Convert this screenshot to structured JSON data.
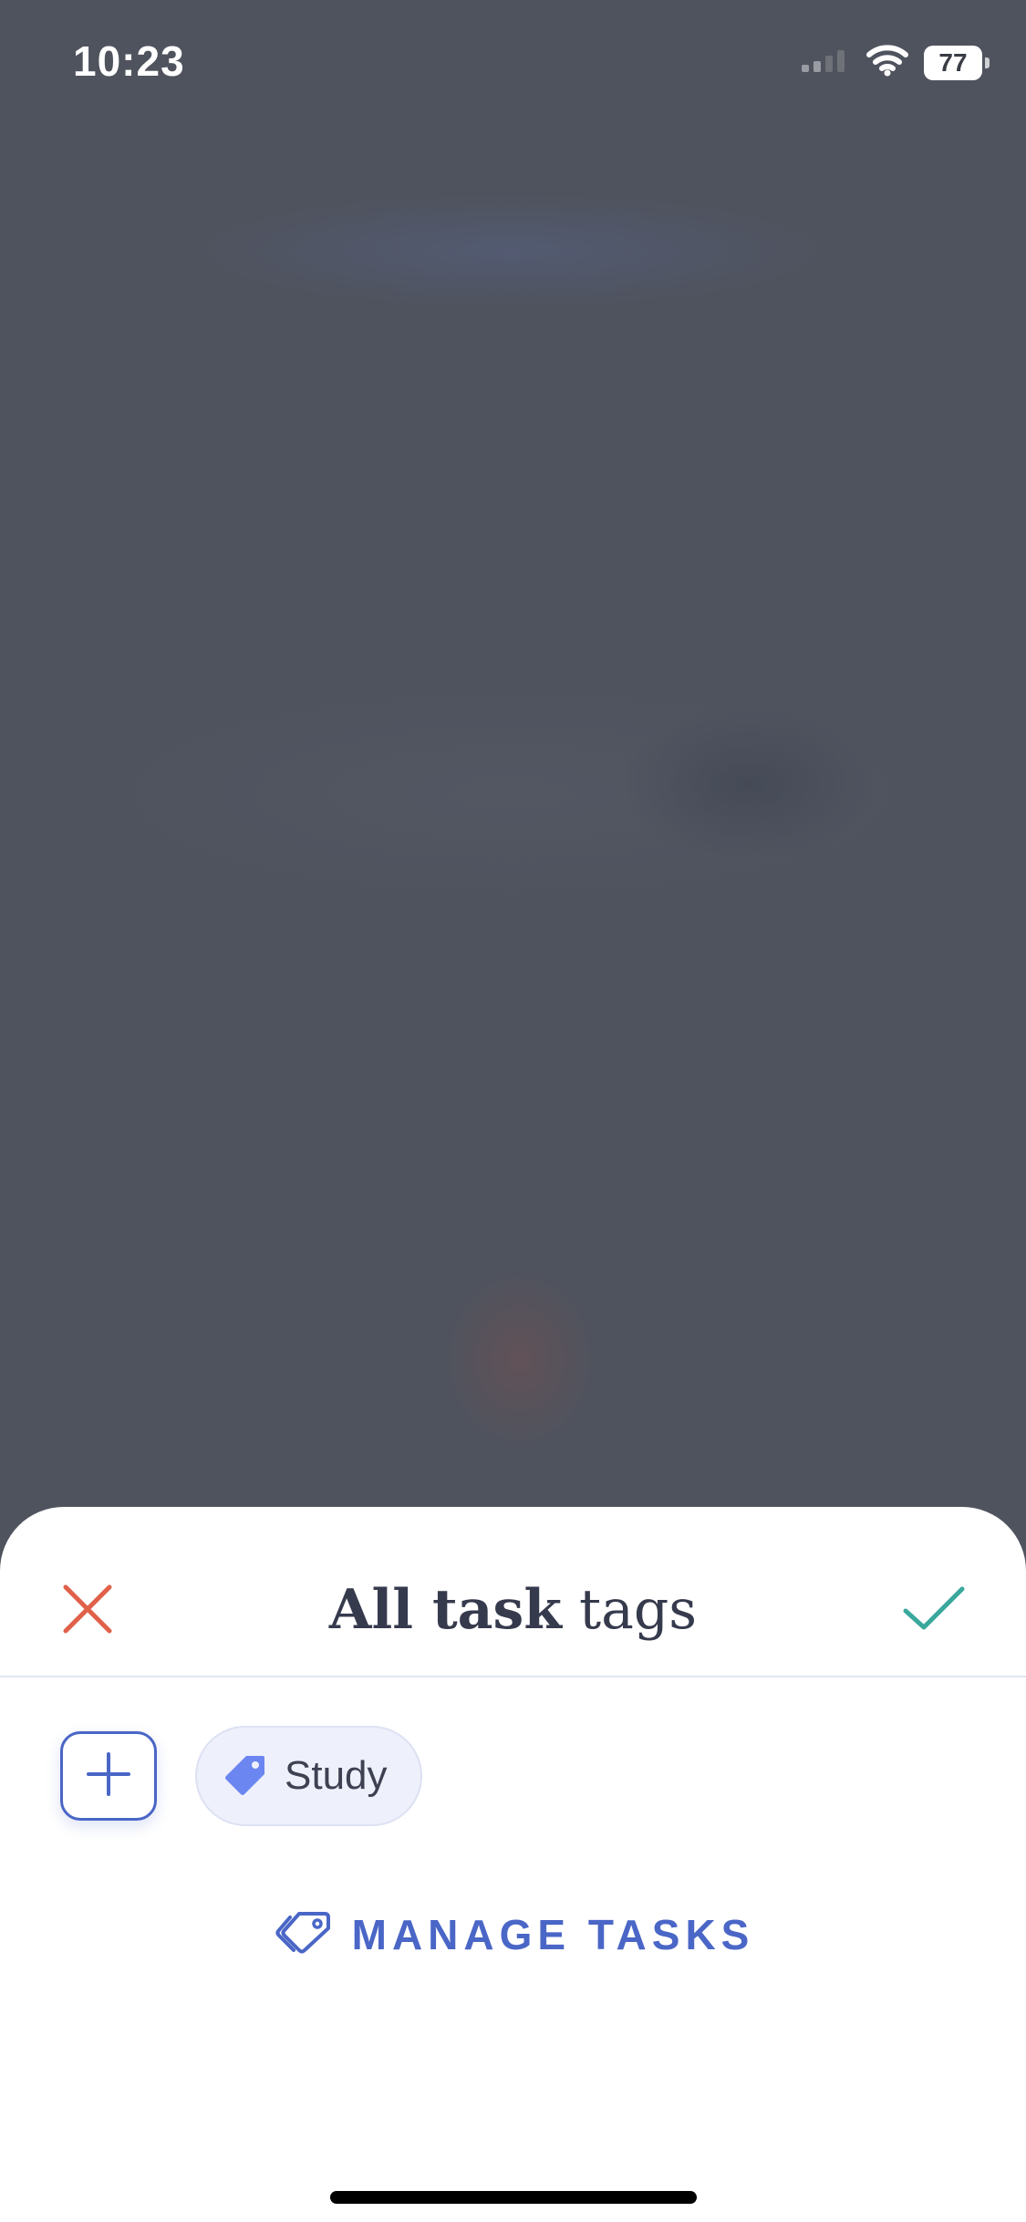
{
  "status_bar": {
    "time": "10:23",
    "battery_level": "77",
    "icons": [
      "signal-icon",
      "wifi-icon",
      "battery-icon"
    ]
  },
  "sheet": {
    "title_strong": "All task",
    "title_light": "tags",
    "close_icon": "close-icon",
    "confirm_icon": "checkmark-icon",
    "add_icon": "plus-icon",
    "tags": [
      {
        "label": "Study",
        "icon": "tag-icon"
      }
    ],
    "manage_label": "MANAGE TASKS",
    "manage_icon": "tags-icon"
  },
  "colors": {
    "accent": "#4a66c6",
    "close": "#e0614a",
    "confirm": "#3aa89c",
    "title": "#363a4d",
    "tag_icon": "#6b86f0",
    "overlay": "#4f535e"
  }
}
